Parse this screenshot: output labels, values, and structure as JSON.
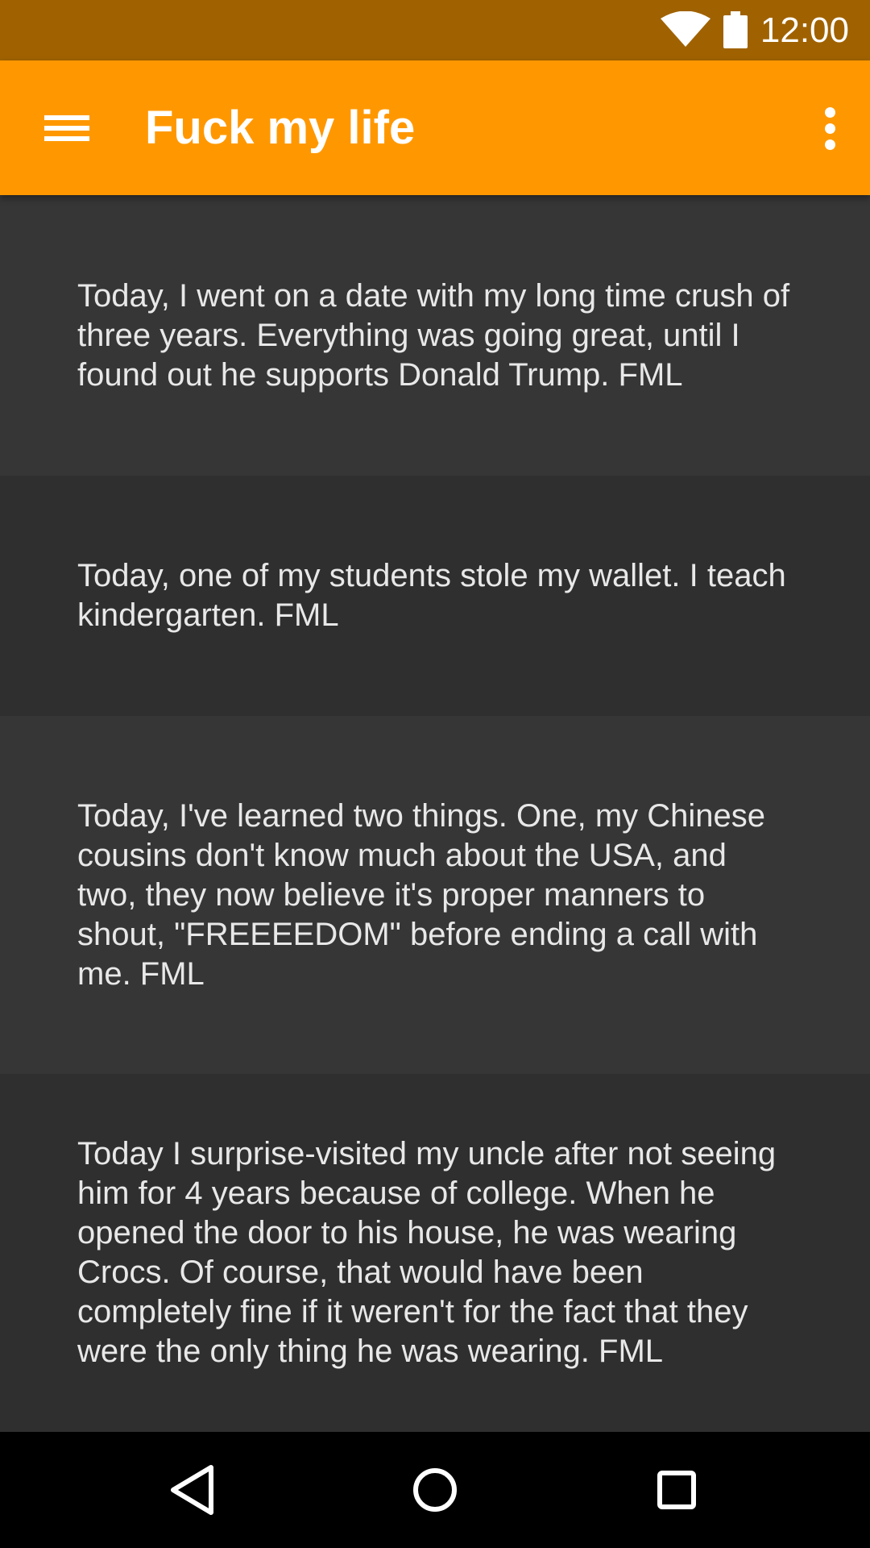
{
  "status_bar": {
    "time": "12:00",
    "icons": [
      "wifi-icon",
      "battery-icon"
    ]
  },
  "app_bar": {
    "title": "Fuck my life",
    "icons": [
      "menu-icon",
      "overflow-menu-icon"
    ]
  },
  "colors": {
    "status_bar": "#a06200",
    "app_bar": "#ff9800",
    "card_light": "#363636",
    "card_dark": "#2f2f2f",
    "text": "#e8e8e8"
  },
  "posts": [
    {
      "text": "Today, I went on a date with my long time crush of three years. Everything was going great, until I found out he supports Donald Trump. FML"
    },
    {
      "text": "Today, one of my students stole my wallet. I teach kindergarten. FML"
    },
    {
      "text": "Today, I've learned two things. One, my Chinese cousins don't know much about the USA, and two, they now believe it's proper manners to shout, \"FREEEEDOM\" before ending a call with me. FML"
    },
    {
      "text": "Today I surprise-visited my uncle after not seeing him for 4 years because of college. When he opened the door to his house, he was wearing Crocs. Of course, that would have been completely fine if it weren't for the fact that they were the only thing he was wearing. FML"
    }
  ],
  "nav_bar": {
    "icons": [
      "back-icon",
      "home-icon",
      "recents-icon"
    ]
  }
}
